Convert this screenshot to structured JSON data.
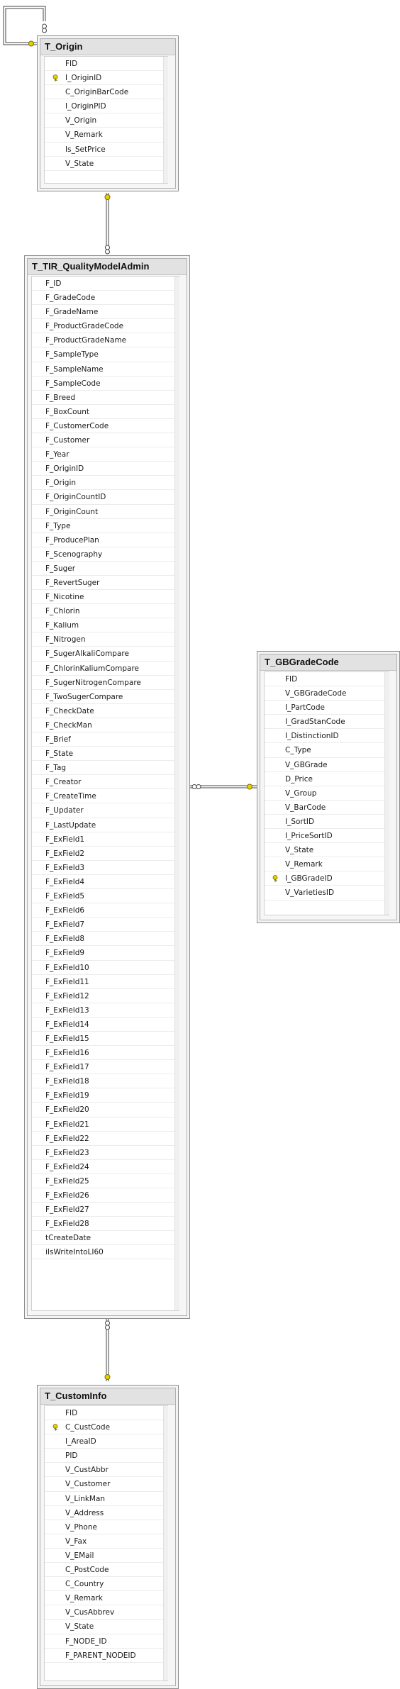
{
  "colors": {
    "key": "#e8d000",
    "connector": "#444444",
    "table_bg": "#f4f4f4"
  },
  "tables": {
    "origin": {
      "title": "T_Origin",
      "columns": [
        {
          "name": "FID",
          "pk": false
        },
        {
          "name": "I_OriginID",
          "pk": true
        },
        {
          "name": "C_OriginBarCode",
          "pk": false
        },
        {
          "name": "I_OriginPID",
          "pk": false
        },
        {
          "name": "V_Origin",
          "pk": false
        },
        {
          "name": "V_Remark",
          "pk": false
        },
        {
          "name": "Is_SetPrice",
          "pk": false
        },
        {
          "name": "V_State",
          "pk": false
        }
      ]
    },
    "quality": {
      "title": "T_TIR_QualityModelAdmin",
      "columns": [
        {
          "name": "F_ID",
          "pk": false
        },
        {
          "name": "F_GradeCode",
          "pk": false
        },
        {
          "name": "F_GradeName",
          "pk": false
        },
        {
          "name": "F_ProductGradeCode",
          "pk": false
        },
        {
          "name": "F_ProductGradeName",
          "pk": false
        },
        {
          "name": "F_SampleType",
          "pk": false
        },
        {
          "name": "F_SampleName",
          "pk": false
        },
        {
          "name": "F_SampleCode",
          "pk": false
        },
        {
          "name": "F_Breed",
          "pk": false
        },
        {
          "name": "F_BoxCount",
          "pk": false
        },
        {
          "name": "F_CustomerCode",
          "pk": false
        },
        {
          "name": "F_Customer",
          "pk": false
        },
        {
          "name": "F_Year",
          "pk": false
        },
        {
          "name": "F_OriginID",
          "pk": false
        },
        {
          "name": "F_Origin",
          "pk": false
        },
        {
          "name": "F_OriginCountID",
          "pk": false
        },
        {
          "name": "F_OriginCount",
          "pk": false
        },
        {
          "name": "F_Type",
          "pk": false
        },
        {
          "name": "F_ProducePlan",
          "pk": false
        },
        {
          "name": "F_Scenography",
          "pk": false
        },
        {
          "name": "F_Suger",
          "pk": false
        },
        {
          "name": "F_RevertSuger",
          "pk": false
        },
        {
          "name": "F_Nicotine",
          "pk": false
        },
        {
          "name": "F_Chlorin",
          "pk": false
        },
        {
          "name": "F_Kalium",
          "pk": false
        },
        {
          "name": "F_Nitrogen",
          "pk": false
        },
        {
          "name": "F_SugerAlkaliCompare",
          "pk": false
        },
        {
          "name": "F_ChlorinKaliumCompare",
          "pk": false
        },
        {
          "name": "F_SugerNitrogenCompare",
          "pk": false
        },
        {
          "name": "F_TwoSugerCompare",
          "pk": false
        },
        {
          "name": "F_CheckDate",
          "pk": false
        },
        {
          "name": "F_CheckMan",
          "pk": false
        },
        {
          "name": "F_Brief",
          "pk": false
        },
        {
          "name": "F_State",
          "pk": false
        },
        {
          "name": "F_Tag",
          "pk": false
        },
        {
          "name": "F_Creator",
          "pk": false
        },
        {
          "name": "F_CreateTime",
          "pk": false
        },
        {
          "name": "F_Updater",
          "pk": false
        },
        {
          "name": "F_LastUpdate",
          "pk": false
        },
        {
          "name": "F_ExField1",
          "pk": false
        },
        {
          "name": "F_ExField2",
          "pk": false
        },
        {
          "name": "F_ExField3",
          "pk": false
        },
        {
          "name": "F_ExField4",
          "pk": false
        },
        {
          "name": "F_ExField5",
          "pk": false
        },
        {
          "name": "F_ExField6",
          "pk": false
        },
        {
          "name": "F_ExField7",
          "pk": false
        },
        {
          "name": "F_ExField8",
          "pk": false
        },
        {
          "name": "F_ExField9",
          "pk": false
        },
        {
          "name": "F_ExField10",
          "pk": false
        },
        {
          "name": "F_ExField11",
          "pk": false
        },
        {
          "name": "F_ExField12",
          "pk": false
        },
        {
          "name": "F_ExField13",
          "pk": false
        },
        {
          "name": "F_ExField14",
          "pk": false
        },
        {
          "name": "F_ExField15",
          "pk": false
        },
        {
          "name": "F_ExField16",
          "pk": false
        },
        {
          "name": "F_ExField17",
          "pk": false
        },
        {
          "name": "F_ExField18",
          "pk": false
        },
        {
          "name": "F_ExField19",
          "pk": false
        },
        {
          "name": "F_ExField20",
          "pk": false
        },
        {
          "name": "F_ExField21",
          "pk": false
        },
        {
          "name": "F_ExField22",
          "pk": false
        },
        {
          "name": "F_ExField23",
          "pk": false
        },
        {
          "name": "F_ExField24",
          "pk": false
        },
        {
          "name": "F_ExField25",
          "pk": false
        },
        {
          "name": "F_ExField26",
          "pk": false
        },
        {
          "name": "F_ExField27",
          "pk": false
        },
        {
          "name": "F_ExField28",
          "pk": false
        },
        {
          "name": "tCreateDate",
          "pk": false
        },
        {
          "name": "iIsWriteIntoLI60",
          "pk": false
        }
      ]
    },
    "gbgrade": {
      "title": "T_GBGradeCode",
      "columns": [
        {
          "name": "FID",
          "pk": false
        },
        {
          "name": "V_GBGradeCode",
          "pk": false
        },
        {
          "name": "I_PartCode",
          "pk": false
        },
        {
          "name": "I_GradStanCode",
          "pk": false
        },
        {
          "name": "I_DistinctionID",
          "pk": false
        },
        {
          "name": "C_Type",
          "pk": false
        },
        {
          "name": "V_GBGrade",
          "pk": false
        },
        {
          "name": "D_Price",
          "pk": false
        },
        {
          "name": "V_Group",
          "pk": false
        },
        {
          "name": "V_BarCode",
          "pk": false
        },
        {
          "name": "I_SortID",
          "pk": false
        },
        {
          "name": "I_PriceSortID",
          "pk": false
        },
        {
          "name": "V_State",
          "pk": false
        },
        {
          "name": "V_Remark",
          "pk": false
        },
        {
          "name": "I_GBGradeID",
          "pk": true
        },
        {
          "name": "V_VarietiesID",
          "pk": false
        }
      ]
    },
    "custom": {
      "title": "T_CustomInfo",
      "columns": [
        {
          "name": "FID",
          "pk": false
        },
        {
          "name": "C_CustCode",
          "pk": true
        },
        {
          "name": "I_AreaID",
          "pk": false
        },
        {
          "name": "PID",
          "pk": false
        },
        {
          "name": "V_CustAbbr",
          "pk": false
        },
        {
          "name": "V_Customer",
          "pk": false
        },
        {
          "name": "V_LinkMan",
          "pk": false
        },
        {
          "name": "V_Address",
          "pk": false
        },
        {
          "name": "V_Phone",
          "pk": false
        },
        {
          "name": "V_Fax",
          "pk": false
        },
        {
          "name": "V_EMail",
          "pk": false
        },
        {
          "name": "C_PostCode",
          "pk": false
        },
        {
          "name": "C_Country",
          "pk": false
        },
        {
          "name": "V_Remark",
          "pk": false
        },
        {
          "name": "V_CusAbbrev",
          "pk": false
        },
        {
          "name": "V_State",
          "pk": false
        },
        {
          "name": "F_NODE_ID",
          "pk": false
        },
        {
          "name": "F_PARENT_NODEID",
          "pk": false
        }
      ]
    }
  }
}
